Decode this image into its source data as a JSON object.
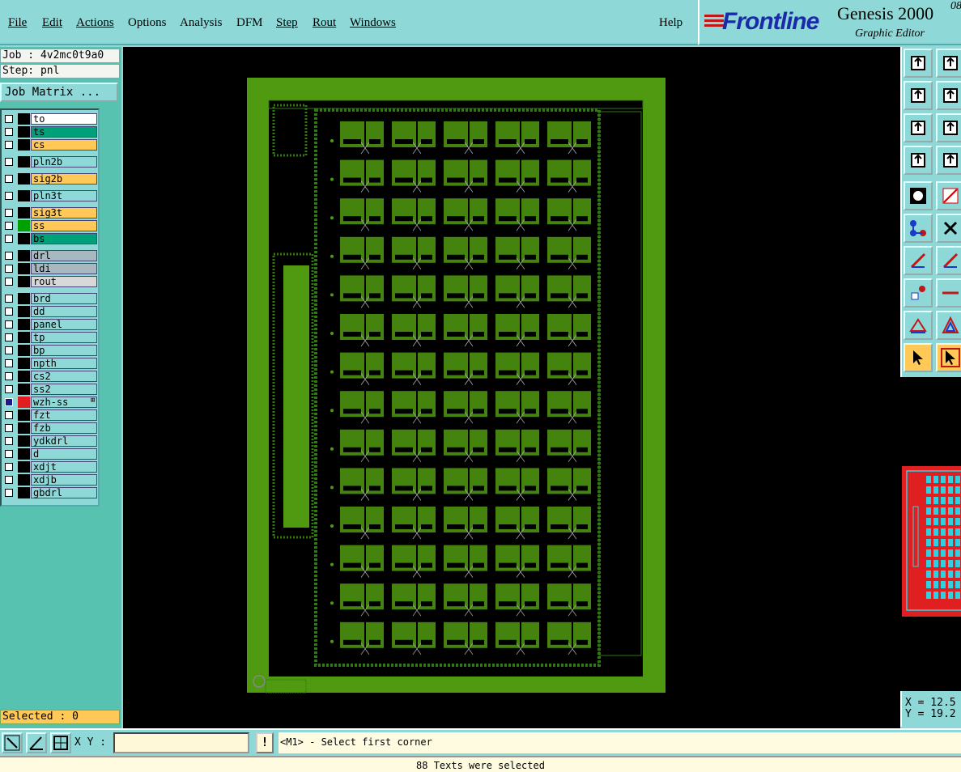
{
  "menu": {
    "items": [
      "File",
      "Edit",
      "Actions",
      "Options",
      "Analysis",
      "DFM",
      "Step",
      "Rout",
      "Windows"
    ],
    "help": "Help"
  },
  "brand": {
    "logo": "Frontline",
    "product": "Genesis 2000",
    "subtitle": "Graphic Editor",
    "version_fragment": "08"
  },
  "job": {
    "job_line": "Job : 4v2mc0t9a0",
    "step_line": "Step: pnl",
    "matrix_button": "Job Matrix ..."
  },
  "layers": [
    {
      "name": "to",
      "color": "#ffffff",
      "swatch": "#000000"
    },
    {
      "name": "ts",
      "color": "#00a07a",
      "swatch": "#000000"
    },
    {
      "name": "cs",
      "color": "#ffc857",
      "swatch": "#000000"
    },
    {
      "name": "pln2b",
      "color": "#8fd8d8",
      "swatch": "#000000",
      "gap": true
    },
    {
      "name": "sig2b",
      "color": "#ffc857",
      "swatch": "#000000",
      "gap": true
    },
    {
      "name": "pln3t",
      "color": "#8fd8d8",
      "swatch": "#000000",
      "gap": true
    },
    {
      "name": "sig3t",
      "color": "#ffc857",
      "swatch": "#000000",
      "gap": true
    },
    {
      "name": "ss",
      "color": "#ffc857",
      "swatch": "#00a000"
    },
    {
      "name": "bs",
      "color": "#00a07a",
      "swatch": "#000000"
    },
    {
      "name": "drl",
      "color": "#a8b8c0",
      "swatch": "#000000",
      "gap": true
    },
    {
      "name": "ldi",
      "color": "#a8b8c0",
      "swatch": "#000000"
    },
    {
      "name": "rout",
      "color": "#d8d8d8",
      "swatch": "#000000"
    },
    {
      "name": "brd",
      "color": "#8fd8d8",
      "swatch": "#000000",
      "gap": true
    },
    {
      "name": "dd",
      "color": "#8fd8d8",
      "swatch": "#000000"
    },
    {
      "name": "panel",
      "color": "#8fd8d8",
      "swatch": "#000000"
    },
    {
      "name": "tp",
      "color": "#8fd8d8",
      "swatch": "#000000"
    },
    {
      "name": "bp",
      "color": "#8fd8d8",
      "swatch": "#000000"
    },
    {
      "name": "npth",
      "color": "#8fd8d8",
      "swatch": "#000000"
    },
    {
      "name": "cs2",
      "color": "#8fd8d8",
      "swatch": "#000000"
    },
    {
      "name": "ss2",
      "color": "#8fd8d8",
      "swatch": "#000000"
    },
    {
      "name": "wzh-ss",
      "color": "#8fd8d8",
      "swatch": "#e02020",
      "active": true
    },
    {
      "name": "fzt",
      "color": "#8fd8d8",
      "swatch": "#000000"
    },
    {
      "name": "fzb",
      "color": "#8fd8d8",
      "swatch": "#000000"
    },
    {
      "name": "ydkdrl",
      "color": "#8fd8d8",
      "swatch": "#000000"
    },
    {
      "name": "d",
      "color": "#8fd8d8",
      "swatch": "#000000"
    },
    {
      "name": "xdjt",
      "color": "#8fd8d8",
      "swatch": "#000000"
    },
    {
      "name": "xdjb",
      "color": "#8fd8d8",
      "swatch": "#000000"
    },
    {
      "name": "gbdrl",
      "color": "#8fd8d8",
      "swatch": "#000000"
    }
  ],
  "selected_line": "Selected : 0",
  "coords": {
    "x": "X = 12.5",
    "y": "Y = 19.2"
  },
  "bottom": {
    "xy_label": "X Y :",
    "xy_value": "",
    "msg_icon": "!",
    "prompt": "<M1> - Select first corner"
  },
  "status": "88 Texts were selected",
  "colors": {
    "pcb_green": "#4f9a10",
    "trace_green": "#2f7a10",
    "selection": "#e02020",
    "overview_cyan": "#30d0e0"
  }
}
